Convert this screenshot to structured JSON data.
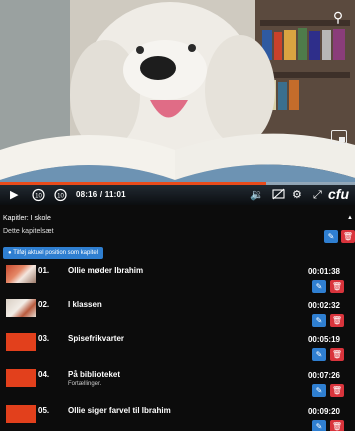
{
  "player": {
    "current_time": "08:16",
    "total_time": "11:01",
    "progress_fraction": 0.75,
    "brand": "cfu",
    "accent_color": "#e84b1c"
  },
  "icons": {
    "search": "search-icon",
    "play": "play-icon",
    "rewind": "rewind-10-icon",
    "forward": "forward-10-icon",
    "volume": "volume-icon",
    "subtitles": "subtitles-off-icon",
    "settings": "gear-icon",
    "fullscreen": "fullscreen-icon",
    "pip": "picture-in-picture-icon",
    "edit": "pencil-icon",
    "delete": "trash-icon"
  },
  "chapters": {
    "header": "Kapitler: I skole",
    "subheader": "Dette kapitelsæt",
    "add_button": "Tilføj aktuel position som kapitel",
    "items": [
      {
        "number": "01.",
        "title": "Ollie møder Ibrahim",
        "description": "",
        "duration": "00:01:38"
      },
      {
        "number": "02.",
        "title": "I klassen",
        "description": "",
        "duration": "00:02:32"
      },
      {
        "number": "03.",
        "title": "Spisefrikvarter",
        "description": "",
        "duration": "00:05:19"
      },
      {
        "number": "04.",
        "title": "På biblioteket",
        "description": "Fortællinger.",
        "duration": "00:07:26"
      },
      {
        "number": "05.",
        "title": "Ollie siger farvel til Ibrahim",
        "description": "",
        "duration": "00:09:20"
      }
    ]
  },
  "colors": {
    "edit_button": "#2f7fd1",
    "delete_button": "#d9343c",
    "thumbnail": "#e2401c"
  }
}
